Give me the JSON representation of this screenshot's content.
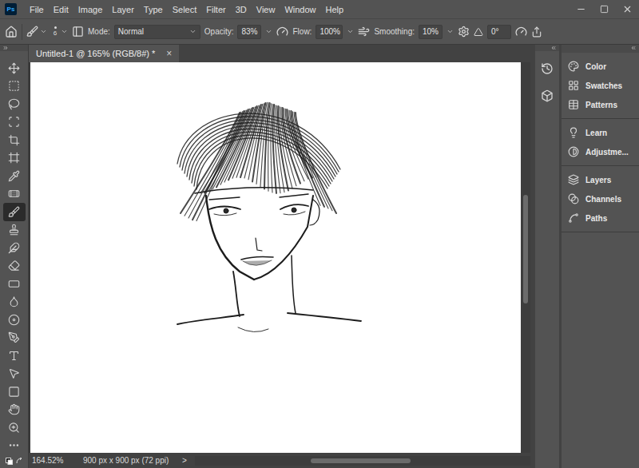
{
  "app": {
    "logo": "Ps"
  },
  "menu": [
    "File",
    "Edit",
    "Image",
    "Layer",
    "Type",
    "Select",
    "Filter",
    "3D",
    "View",
    "Window",
    "Help"
  ],
  "options_bar": {
    "brush_size": "6",
    "mode": {
      "label": "Mode:",
      "value": "Normal"
    },
    "opacity": {
      "label": "Opacity:",
      "value": "83%"
    },
    "flow": {
      "label": "Flow:",
      "value": "100%"
    },
    "smoothing": {
      "label": "Smoothing:",
      "value": "10%"
    },
    "angle": "0°"
  },
  "document": {
    "tab_title": "Untitled-1 @ 165% (RGB/8#) *",
    "tab_close": "×"
  },
  "tools": [
    {
      "selected": false
    },
    {
      "selected": false
    },
    {
      "selected": false
    },
    {
      "selected": false
    },
    {
      "selected": false
    },
    {
      "selected": false
    },
    {
      "selected": false
    },
    {
      "selected": false
    },
    {
      "selected": true
    },
    {
      "selected": false
    },
    {
      "selected": false
    },
    {
      "selected": false
    },
    {
      "selected": false
    },
    {
      "selected": false
    },
    {
      "selected": false
    },
    {
      "selected": false
    },
    {
      "selected": false
    },
    {
      "selected": false
    },
    {
      "selected": false
    },
    {
      "selected": false
    },
    {
      "selected": false
    }
  ],
  "status_bar": {
    "zoom": "164.52%",
    "doc_info": "900 px x 900 px (72 ppi)",
    "arrow": ">"
  },
  "panel_groups": [
    [
      {
        "label": "Color"
      },
      {
        "label": "Swatches"
      },
      {
        "label": "Patterns"
      }
    ],
    [
      {
        "label": "Learn"
      },
      {
        "label": "Adjustme..."
      }
    ],
    [
      {
        "label": "Layers"
      },
      {
        "label": "Channels"
      },
      {
        "label": "Paths"
      }
    ]
  ]
}
